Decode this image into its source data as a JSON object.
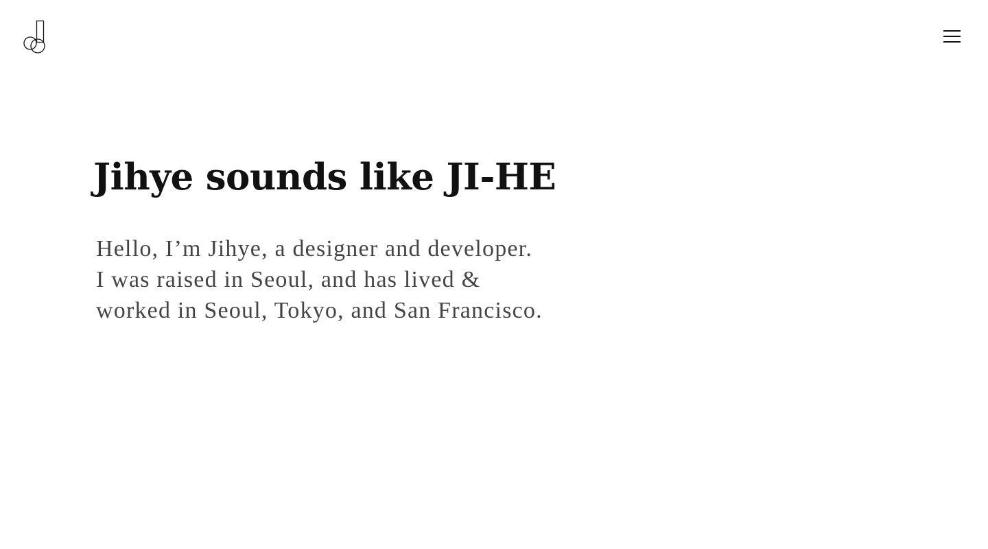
{
  "header": {
    "logo_icon": "jd-monogram-logo-icon",
    "menu_icon": "hamburger-menu-icon"
  },
  "hero": {
    "headline": "Jihye sounds like JI-HE",
    "intro_lines": [
      "Hello, I’m Jihye, a designer and developer.",
      "I was raised in Seoul, and has lived &",
      "worked in Seoul, Tokyo, and San Francisco."
    ]
  },
  "colors": {
    "background": "#ffffff",
    "headline": "#111111",
    "body_text": "#454545",
    "icon": "#111111"
  }
}
